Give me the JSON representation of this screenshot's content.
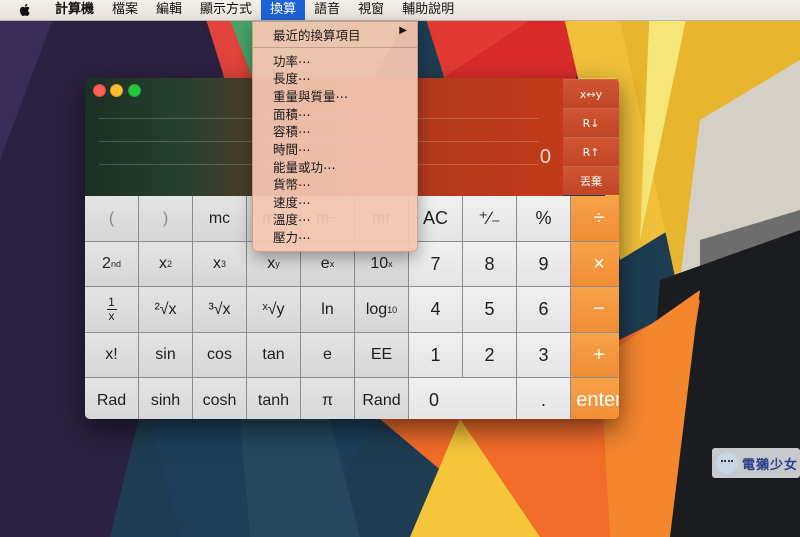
{
  "menubar": {
    "apple_icon": "apple-logo-icon",
    "items": [
      {
        "label": "計算機"
      },
      {
        "label": "檔案"
      },
      {
        "label": "編輯"
      },
      {
        "label": "顯示方式"
      },
      {
        "label": "換算"
      },
      {
        "label": "語音"
      },
      {
        "label": "視窗"
      },
      {
        "label": "輔助說明"
      }
    ],
    "active_index": 4
  },
  "conversion_menu": {
    "recent_label": "最近的換算項目",
    "submenu_arrow": "▶",
    "items": [
      "功率⋯",
      "長度⋯",
      "重量與質量⋯",
      "面積⋯",
      "容積⋯",
      "時間⋯",
      "能量或功⋯",
      "貨幣⋯",
      "速度⋯",
      "溫度⋯",
      "壓力⋯"
    ]
  },
  "calculator": {
    "display_value": "0",
    "rpn_keys": [
      "x↔y",
      "R↓",
      "R↑",
      "丟棄"
    ],
    "keys": {
      "open_paren": "(",
      "close_paren": ")",
      "mc": "mc",
      "mplus": "m+",
      "mminus": "m−",
      "mr": "mr",
      "ac": "AC",
      "plus_minus": "⁺∕₋",
      "percent": "%",
      "divide": "÷",
      "second": "2",
      "second_sup": "nd",
      "x": "x",
      "sup2": "2",
      "sup3": "3",
      "supy": "y",
      "e": "e",
      "ten": "10",
      "seven": "7",
      "eight": "8",
      "nine": "9",
      "multiply": "×",
      "one": "1",
      "recip_x": "x",
      "sqrt2": "²√x",
      "sqrt3": "³√x",
      "sqrty": "ˣ√y",
      "ln": "ln",
      "log": "log",
      "log_sub": "10",
      "four": "4",
      "five": "5",
      "six": "6",
      "minus": "−",
      "factorial": "x!",
      "sin": "sin",
      "cos": "cos",
      "tan": "tan",
      "ee": "EE",
      "two": "2",
      "three": "3",
      "plus": "+",
      "rad": "Rad",
      "sinh": "sinh",
      "cosh": "cosh",
      "tanh": "tanh",
      "pi": "π",
      "rand": "Rand",
      "zero": "0",
      "decimal": ".",
      "enter": "enter"
    }
  },
  "watermark": {
    "text": "電獺少女"
  },
  "colors": {
    "menu_highlight": "#1d62d6",
    "operator_orange": "#f39038",
    "rpn_red": "#c84b2b"
  }
}
